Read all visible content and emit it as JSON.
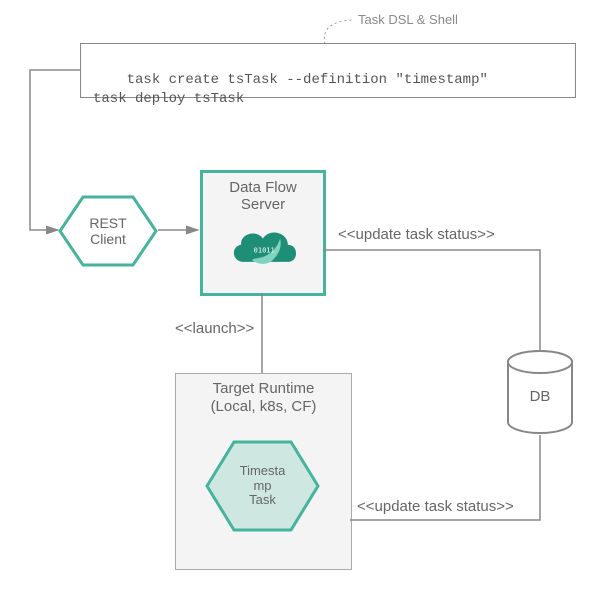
{
  "callout": "Task  DSL & Shell",
  "code": {
    "line1": "task create tsTask --definition \"timestamp\"",
    "line2": "task deploy tsTask"
  },
  "nodes": {
    "restClient": {
      "line1": "REST",
      "line2": "Client"
    },
    "server": {
      "line1": "Data Flow",
      "line2": "Server"
    },
    "runtime": {
      "line1": "Target Runtime",
      "line2": "(Local, k8s, CF)"
    },
    "task": {
      "line1": "Timesta",
      "line2": "mp",
      "line3": "Task"
    },
    "db": "DB"
  },
  "edges": {
    "updateStatusTop": "<<update task status>>",
    "launch": "<<launch>>",
    "updateStatusBottom": "<<update task status>>"
  },
  "colors": {
    "teal": "#45b39d",
    "lightTeal": "#cfe7e1",
    "panel": "#f4f4f4",
    "textGray": "#666",
    "lineGray": "#888"
  }
}
